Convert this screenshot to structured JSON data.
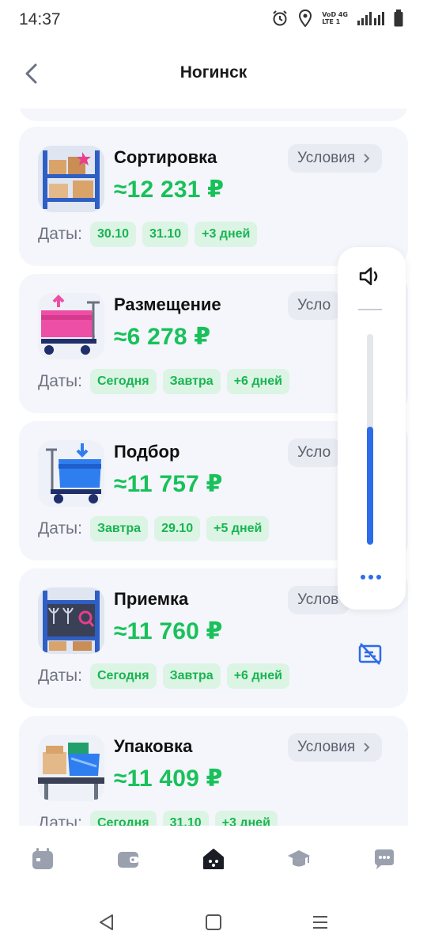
{
  "status_bar": {
    "time": "14:37",
    "network_top": "VoD 4G",
    "network_bottom": "LTE 1"
  },
  "header": {
    "title": "Ногинск"
  },
  "cards": [
    {
      "name": "Сортировка",
      "price": "≈12 231 ₽",
      "conditions_label": "Условия",
      "dates_label": "Даты:",
      "chips": [
        "30.10",
        "31.10",
        "+3 дней"
      ],
      "icon": "warehouse-shelf-icon"
    },
    {
      "name": "Размещение",
      "price": "≈6 278 ₽",
      "conditions_label": "Усло",
      "dates_label": "Даты:",
      "chips": [
        "Сегодня",
        "Завтра",
        "+6 дней"
      ],
      "icon": "cart-pink-icon"
    },
    {
      "name": "Подбор",
      "price": "≈11 757 ₽",
      "conditions_label": "Усло",
      "dates_label": "Даты:",
      "chips": [
        "Завтра",
        "29.10",
        "+5 дней"
      ],
      "icon": "cart-blue-icon"
    },
    {
      "name": "Приемка",
      "price": "≈11 760 ₽",
      "conditions_label": "Услов",
      "dates_label": "Даты:",
      "chips": [
        "Сегодня",
        "Завтра",
        "+6 дней"
      ],
      "icon": "shelf-glasses-icon"
    },
    {
      "name": "Упаковка",
      "price": "≈11 409 ₽",
      "conditions_label": "Условия",
      "dates_label": "Даты:",
      "chips": [
        "Сегодня",
        "31.10",
        "+3 дней"
      ],
      "icon": "packing-table-icon"
    }
  ],
  "volume_panel": {
    "level": 0.56
  },
  "bottom_nav": [
    "calendar-icon",
    "wallet-icon",
    "home-icon",
    "graduation-cap-icon",
    "chat-icon"
  ],
  "colors": {
    "price_green": "#19c15a",
    "chip_bg": "#dcf4e4",
    "card_bg": "#f4f6fb",
    "accent_blue": "#2d6bea"
  }
}
